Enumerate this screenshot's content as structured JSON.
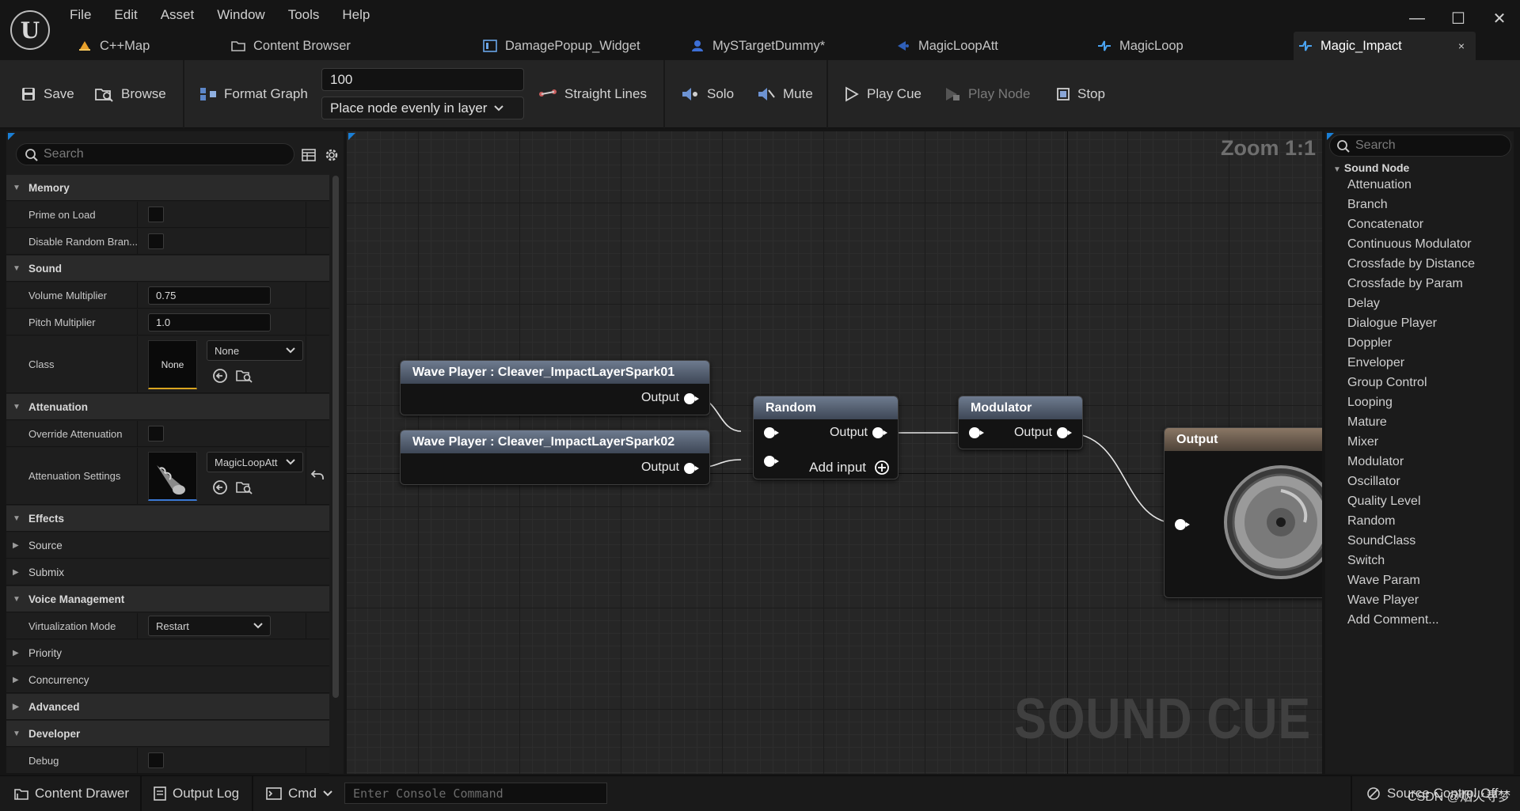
{
  "app": {
    "logo": "U"
  },
  "menu": [
    "File",
    "Edit",
    "Asset",
    "Window",
    "Tools",
    "Help"
  ],
  "window_controls": {
    "minimize": "—",
    "maximize": "☐",
    "close": "✕"
  },
  "tabs": [
    {
      "label": "C++Map",
      "icon": "level-icon"
    },
    {
      "label": "Content Browser",
      "icon": "folder-icon"
    },
    {
      "label": "DamagePopup_Widget",
      "icon": "widget-icon"
    },
    {
      "label": "MySTargetDummy*",
      "icon": "blueprint-icon"
    },
    {
      "label": "MagicLoopAtt",
      "icon": "attenuation-icon"
    },
    {
      "label": "MagicLoop",
      "icon": "soundcue-icon"
    },
    {
      "label": "Magic_Impact",
      "icon": "soundcue-icon",
      "active": true
    }
  ],
  "tab_close": "×",
  "toolbar": {
    "save": "Save",
    "browse": "Browse",
    "format_graph": "Format Graph",
    "spacing_value": "100",
    "layout_mode": "Place node evenly in layer",
    "straight_lines": "Straight Lines",
    "solo": "Solo",
    "mute": "Mute",
    "play_cue": "Play Cue",
    "play_node": "Play Node",
    "stop": "Stop"
  },
  "details": {
    "search_placeholder": "Search",
    "categories": {
      "memory": "Memory",
      "sound": "Sound",
      "attenuation": "Attenuation",
      "effects": "Effects",
      "voice_management": "Voice Management",
      "advanced": "Advanced",
      "developer": "Developer"
    },
    "props": {
      "prime_on_load": "Prime on Load",
      "disable_random_branch": "Disable Random Bran...",
      "volume_multiplier": "Volume Multiplier",
      "volume_multiplier_value": "0.75",
      "pitch_multiplier": "Pitch Multiplier",
      "pitch_multiplier_value": "1.0",
      "class": "Class",
      "class_thumb": "None",
      "class_value": "None",
      "override_attenuation": "Override Attenuation",
      "attenuation_settings": "Attenuation Settings",
      "attenuation_settings_value": "MagicLoopAtt",
      "source": "Source",
      "submix": "Submix",
      "virtualization_mode": "Virtualization Mode",
      "virtualization_mode_value": "Restart",
      "priority": "Priority",
      "concurrency": "Concurrency",
      "debug": "Debug"
    }
  },
  "graph": {
    "zoom": "Zoom 1:1",
    "watermark": "SOUND CUE",
    "nodes": {
      "wave1": {
        "title": "Wave Player : Cleaver_ImpactLayerSpark01",
        "output": "Output"
      },
      "wave2": {
        "title": "Wave Player : Cleaver_ImpactLayerSpark02",
        "output": "Output"
      },
      "random": {
        "title": "Random",
        "output": "Output",
        "add_input": "Add input"
      },
      "modulator": {
        "title": "Modulator",
        "output": "Output"
      },
      "output": {
        "title": "Output"
      }
    }
  },
  "palette": {
    "search_placeholder": "Search",
    "category": "Sound Node",
    "items": [
      "Attenuation",
      "Branch",
      "Concatenator",
      "Continuous Modulator",
      "Crossfade by Distance",
      "Crossfade by Param",
      "Delay",
      "Dialogue Player",
      "Doppler",
      "Enveloper",
      "Group Control",
      "Looping",
      "Mature",
      "Mixer",
      "Modulator",
      "Oscillator",
      "Quality Level",
      "Random",
      "SoundClass",
      "Switch",
      "Wave Param",
      "Wave Player",
      "Add Comment..."
    ]
  },
  "statusbar": {
    "content_drawer": "Content Drawer",
    "output_log": "Output Log",
    "cmd": "Cmd",
    "console_placeholder": "Enter Console Command",
    "source_control": "Source Control Off",
    "credit": "CSDN @烟火寻梦"
  },
  "colors": {
    "accent_blue": "#1a7fd6",
    "active_tab": "#242424",
    "node_title": "#5c6778",
    "output_node_title": "#7a6a5a",
    "class_underline": "#d9a520",
    "asset_underline": "#3a78d4"
  }
}
